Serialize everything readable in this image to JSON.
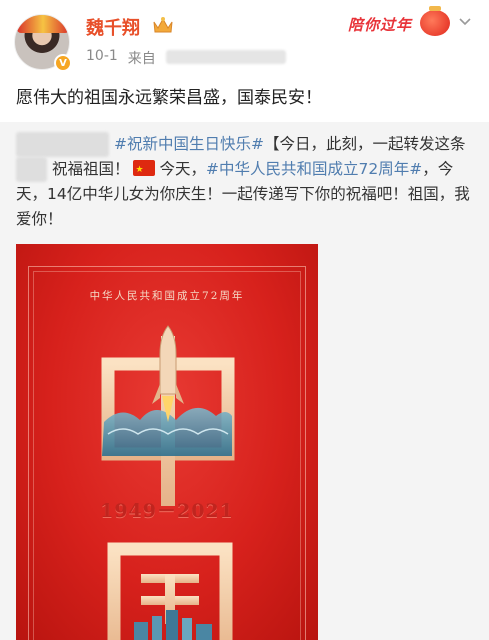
{
  "post": {
    "username": "魏千翔",
    "time": "10-1",
    "source_prefix": "来自",
    "promo_badge": "陪你过年",
    "text": "愿伟大的祖国永远繁荣昌盛，国泰民安！"
  },
  "repost": {
    "topic1": "#祝新中国生日快乐#",
    "seg1": "【今日，此刻，一起转发这条",
    "seg2": "祝福祖国！",
    "seg3": "今天，",
    "topic2": "#中华人民共和国成立72周年#",
    "seg4": "，今天，14亿中华儿女为你庆生！一起传递写下你的祝福吧！祖国，我爱你！"
  },
  "poster": {
    "caption": "中华人民共和国成立72周年",
    "years": "1949－2021",
    "char1": "中",
    "char2": "国"
  },
  "colors": {
    "accent_orange": "#e8502a",
    "topic_blue": "#507daf",
    "poster_red": "#d7211c"
  }
}
